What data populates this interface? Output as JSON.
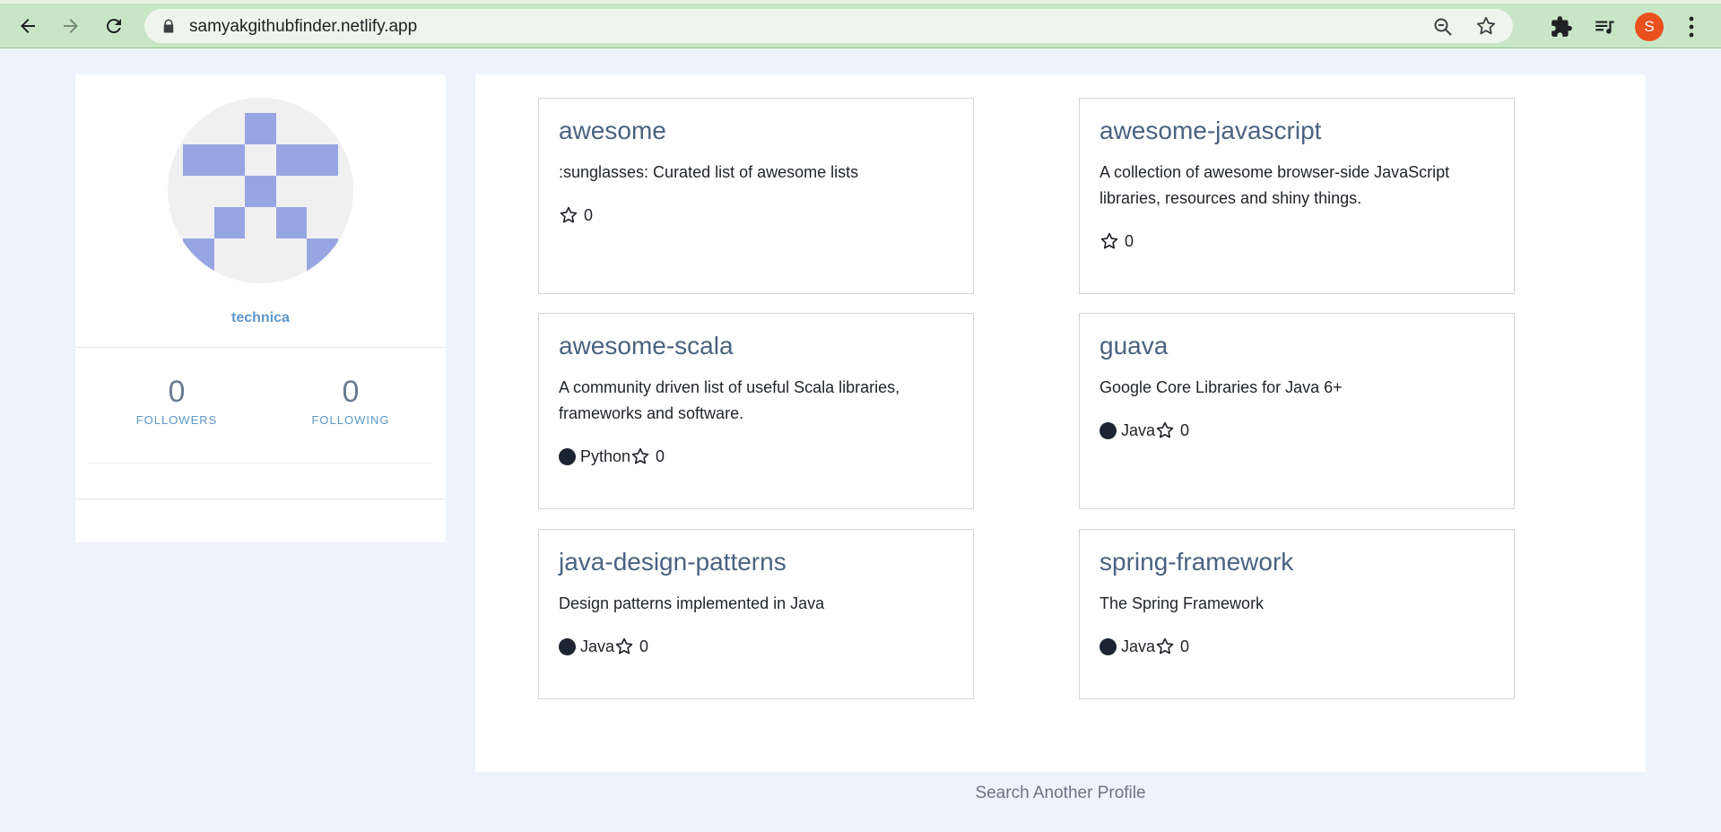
{
  "browser": {
    "url": "samyakgithubfinder.netlify.app",
    "profile_initial": "S",
    "profile_color": "#e8501e"
  },
  "profile": {
    "username": "technica",
    "followers_count": "0",
    "followers_label": "FOLLOWERS",
    "following_count": "0",
    "following_label": "FOLLOWING"
  },
  "repos": [
    {
      "name": "awesome",
      "description": ":sunglasses: Curated list of awesome lists",
      "language": "",
      "stars": "0"
    },
    {
      "name": "awesome-javascript",
      "description": "A collection of awesome browser-side JavaScript libraries, resources and shiny things.",
      "language": "",
      "stars": "0"
    },
    {
      "name": "awesome-scala",
      "description": "A community driven list of useful Scala libraries, frameworks and software.",
      "language": "Python",
      "stars": "0"
    },
    {
      "name": "guava",
      "description": "Google Core Libraries for Java 6+",
      "language": "Java",
      "stars": "0"
    },
    {
      "name": "java-design-patterns",
      "description": "Design patterns implemented in Java",
      "language": "Java",
      "stars": "0"
    },
    {
      "name": "spring-framework",
      "description": "The Spring Framework",
      "language": "Java",
      "stars": "0"
    }
  ],
  "footer": {
    "search_another": "Search Another Profile"
  },
  "colors": {
    "repo_title": "#4a6281",
    "accent_link": "#5d97c9",
    "avatar_identicon": "#97a6e3"
  }
}
